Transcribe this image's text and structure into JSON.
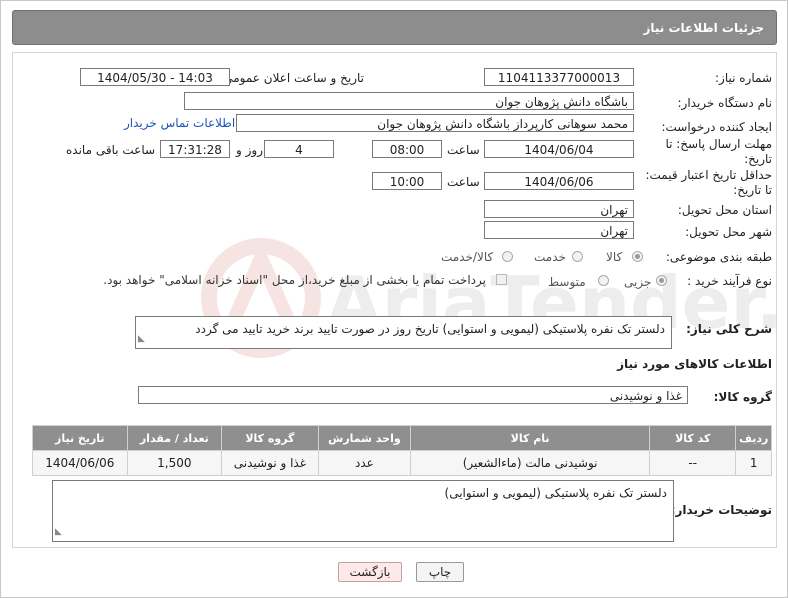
{
  "panel": {
    "title": "جزئیات اطلاعات نیاز"
  },
  "fields": {
    "need_number_label": "شماره نیاز:",
    "need_number": "1104113377000013",
    "announce_label": "تاریخ و ساعت اعلان عمومی:",
    "announce_value": "1404/05/30 - 14:03",
    "buyer_org_label": "نام دستگاه خریدار:",
    "buyer_org": "باشگاه دانش پژوهان جوان",
    "creator_label": "ایجاد کننده درخواست:",
    "creator": "محمد سوهانی کارپرداز  باشگاه دانش پژوهان جوان",
    "contact_link": "اطلاعات تماس خریدار",
    "reply_deadline_label": "مهلت ارسال پاسخ: تا تاریخ:",
    "reply_date": "1404/06/04",
    "time_label": "ساعت",
    "reply_time": "08:00",
    "days": "4",
    "days_label": "روز و",
    "remaining_time": "17:31:28",
    "remaining_label": "ساعت باقی مانده",
    "price_deadline_label": "حداقل تاریخ اعتبار قیمت: تا تاریخ:",
    "price_date": "1404/06/06",
    "price_time": "10:00",
    "province_label": "استان محل تحویل:",
    "province": "تهران",
    "city_label": "شهر محل تحویل:",
    "city": "تهران",
    "category_label": "طبقه بندی موضوعی:",
    "category_options": [
      "کالا",
      "خدمت",
      "کالا/خدمت"
    ],
    "category_selected": "کالا",
    "process_label": "نوع فرآیند خرید :",
    "process_options": [
      "جزیی",
      "متوسط"
    ],
    "process_selected": "جزیی",
    "payment_note": "پرداخت تمام یا بخشی از مبلغ خرید،از محل \"اسناد خزانه اسلامی\" خواهد بود.",
    "description_label": "شرح کلی نیاز:",
    "description": "دلستر تک نفره پلاستیکی (لیمویی و استوایی) تاریخ روز در صورت تایید برند خرید تایید می گردد",
    "goods_info_title": "اطلاعات کالاهای مورد نیاز",
    "goods_group_label": "گروه کالا:",
    "goods_group": "غذا و نوشیدنی",
    "buyer_notes_label": "توضیحات خریدار:",
    "buyer_notes": "دلستر تک نفره پلاستیکی (لیمویی و استوایی)"
  },
  "table": {
    "headers": [
      "ردیف",
      "کد کالا",
      "نام کالا",
      "واحد شمارش",
      "گروه کالا",
      "تعداد / مقدار",
      "تاریخ نیاز"
    ],
    "rows": [
      [
        "1",
        "--",
        "نوشیدنی مالت (ماءالشعیر)",
        "عدد",
        "غذا و نوشیدنی",
        "1,500",
        "1404/06/06"
      ]
    ]
  },
  "buttons": {
    "print": "چاپ",
    "back": "بازگشت"
  },
  "watermark": {
    "text": "AriaTender.net"
  },
  "colors": {
    "header": "#8d8d8d",
    "link": "#1c55b5",
    "back_button": "#fde9e9"
  }
}
